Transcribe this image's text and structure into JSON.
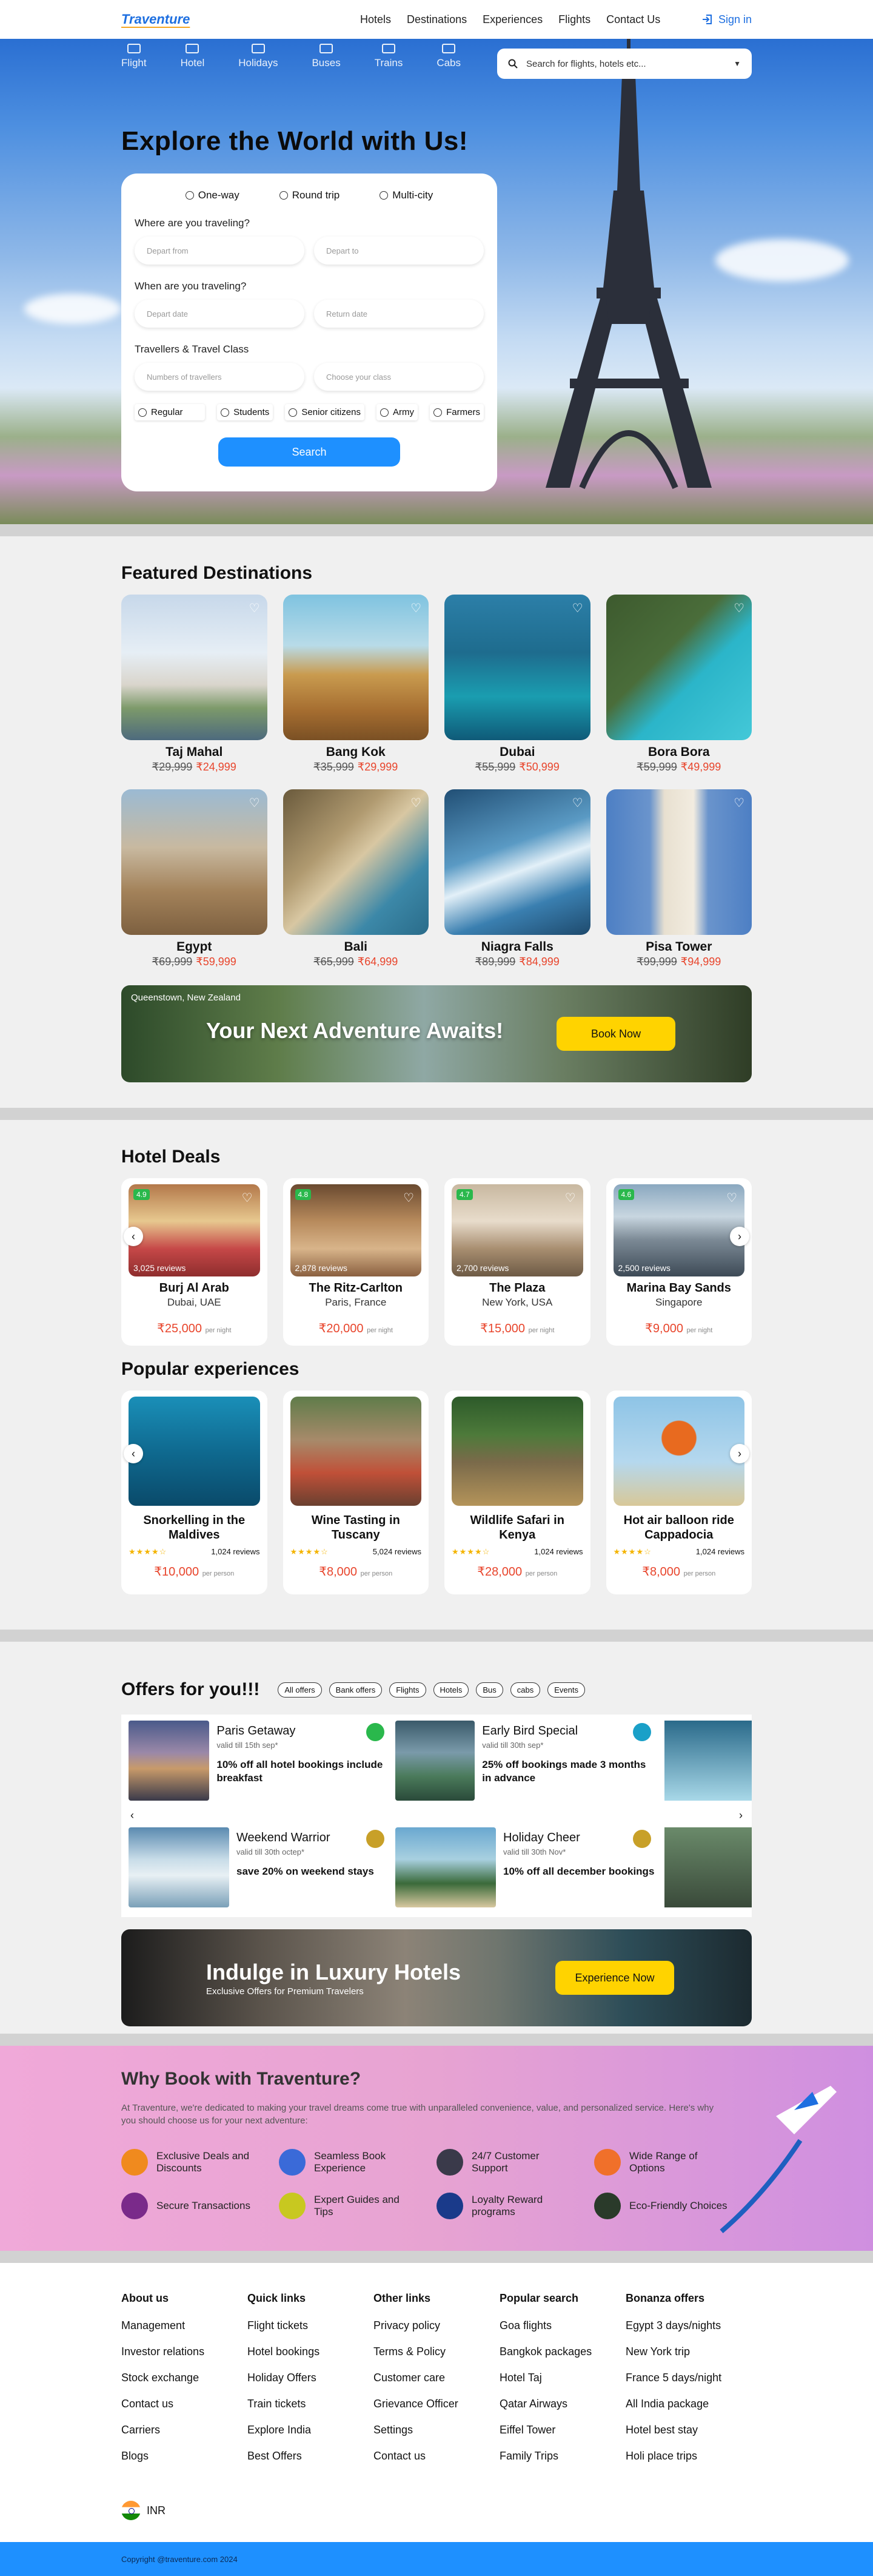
{
  "nav": {
    "logo": "Traventure",
    "links": [
      "Hotels",
      "Destinations",
      "Experiences",
      "Flights",
      "Contact Us"
    ],
    "signin": "Sign in"
  },
  "hero": {
    "modes": [
      "Flight",
      "Hotel",
      "Holidays",
      "Buses",
      "Trains",
      "Cabs"
    ],
    "search_placeholder": "Search for flights, hotels etc...",
    "title": "Explore the World with Us!",
    "trip_types": [
      "One-way",
      "Round trip",
      "Multi-city"
    ],
    "where_label": "Where are you traveling?",
    "depart_from": "Depart from",
    "depart_to": "Depart to",
    "when_label": "When are you traveling?",
    "depart_date": "Depart date",
    "return_date": "Return date",
    "travellers_label": "Travellers & Travel Class",
    "num_travellers": "Numbers of travellers",
    "choose_class": "Choose your class",
    "classes": [
      "Regular",
      "Students",
      "Senior citizens",
      "Army",
      "Farmers"
    ],
    "search_button": "Search"
  },
  "featured": {
    "title": "Featured Destinations",
    "items": [
      {
        "name": "Taj Mahal",
        "old": "₹29,999",
        "new": "₹24,999"
      },
      {
        "name": "Bang Kok",
        "old": "₹35,999",
        "new": "₹29,999"
      },
      {
        "name": "Dubai",
        "old": "₹55,999",
        "new": "₹50,999"
      },
      {
        "name": "Bora Bora",
        "old": "₹59,999",
        "new": "₹49,999"
      },
      {
        "name": "Egypt",
        "old": "₹69,999",
        "new": "₹59,999"
      },
      {
        "name": "Bali",
        "old": "₹65,999",
        "new": "₹64,999"
      },
      {
        "name": "Niagra Falls",
        "old": "₹89,999",
        "new": "₹84,999"
      },
      {
        "name": "Pisa Tower",
        "old": "₹99,999",
        "new": "₹94,999"
      }
    ],
    "banner_sub": "Queenstown, New Zealand",
    "banner_title": "Your Next Adventure Awaits!",
    "banner_button": "Book Now"
  },
  "hotels": {
    "title": "Hotel Deals",
    "per_night": "per night",
    "items": [
      {
        "name": "Burj Al Arab",
        "loc": "Dubai, UAE",
        "price": "₹25,000",
        "rating": "4.9",
        "reviews": "3,025 reviews"
      },
      {
        "name": "The Ritz-Carlton",
        "loc": "Paris, France",
        "price": "₹20,000",
        "rating": "4.8",
        "reviews": "2,878 reviews"
      },
      {
        "name": "The Plaza",
        "loc": "New York, USA",
        "price": "₹15,000",
        "rating": "4.7",
        "reviews": "2,700 reviews"
      },
      {
        "name": "Marina Bay Sands",
        "loc": "Singapore",
        "price": "₹9,000",
        "rating": "4.6",
        "reviews": "2,500 reviews"
      }
    ]
  },
  "experiences": {
    "title": "Popular experiences",
    "per_person": "per person",
    "items": [
      {
        "name": "Snorkelling in the Maldives",
        "reviews": "1,024 reviews",
        "price": "₹10,000",
        "rating": 4.5
      },
      {
        "name": "Wine Tasting in Tuscany",
        "reviews": "5,024 reviews",
        "price": "₹8,000",
        "rating": 4.5
      },
      {
        "name": "Wildlife Safari in Kenya",
        "reviews": "1,024 reviews",
        "price": "₹28,000",
        "rating": 4.5
      },
      {
        "name": "Hot air balloon ride Cappadocia",
        "reviews": "1,024 reviews",
        "price": "₹8,000",
        "rating": 4.5
      }
    ]
  },
  "offers": {
    "title": "Offers for you!!!",
    "chips": [
      "All offers",
      "Bank offers",
      "Flights",
      "Hotels",
      "Bus",
      "cabs",
      "Events"
    ],
    "items": [
      {
        "title": "Paris Getaway",
        "valid": "valid till 15th sep*",
        "desc": "10% off all hotel bookings include breakfast"
      },
      {
        "title": "Early Bird Special",
        "valid": "valid till 30th sep*",
        "desc": "25% off bookings made 3 months in advance"
      },
      {
        "title": "Weekend Warrior",
        "valid": "valid till 30th octep*",
        "desc": "save 20% on weekend stays"
      },
      {
        "title": "Holiday Cheer",
        "valid": "valid till 30th Nov*",
        "desc": "10% off all december bookings"
      }
    ],
    "lux_title": "Indulge in Luxury Hotels",
    "lux_sub": "Exclusive Offers for Premium Travelers",
    "lux_button": "Experience Now"
  },
  "why": {
    "title": "Why Book with Traventure?",
    "desc": "At Traventure, we're dedicated to making your travel dreams come true with unparalleled convenience, value, and personalized service. Here's why you should choose us for your next adventure:",
    "features": [
      "Exclusive Deals and Discounts",
      "Seamless Book Experience",
      "24/7 Customer Support",
      "Wide Range of Options",
      "Secure Transactions",
      "Expert Guides and Tips",
      "Loyalty Reward programs",
      "Eco-Friendly Choices"
    ]
  },
  "footer": {
    "cols": [
      {
        "title": "About us",
        "items": [
          "Management",
          "Investor relations",
          "Stock exchange",
          "Contact us",
          "Carriers",
          "Blogs"
        ]
      },
      {
        "title": "Quick links",
        "items": [
          "Flight tickets",
          "Hotel bookings",
          "Holiday Offers",
          "Train tickets",
          "Explore India",
          "Best Offers"
        ]
      },
      {
        "title": "Other links",
        "items": [
          "Privacy policy",
          "Terms & Policy",
          "Customer care",
          "Grievance Officer",
          "Settings",
          "Contact us"
        ]
      },
      {
        "title": "Popular search",
        "items": [
          "Goa flights",
          "Bangkok packages",
          "Hotel Taj",
          "Qatar Airways",
          "Eiffel Tower",
          "Family Trips"
        ]
      },
      {
        "title": "Bonanza offers",
        "items": [
          "Egypt 3 days/nights",
          "New York trip",
          "France 5 days/night",
          "All India package",
          "Hotel best stay",
          "Holi place trips"
        ]
      }
    ],
    "currency": "INR",
    "copyright": "Copyright @traventure.com 2024"
  }
}
